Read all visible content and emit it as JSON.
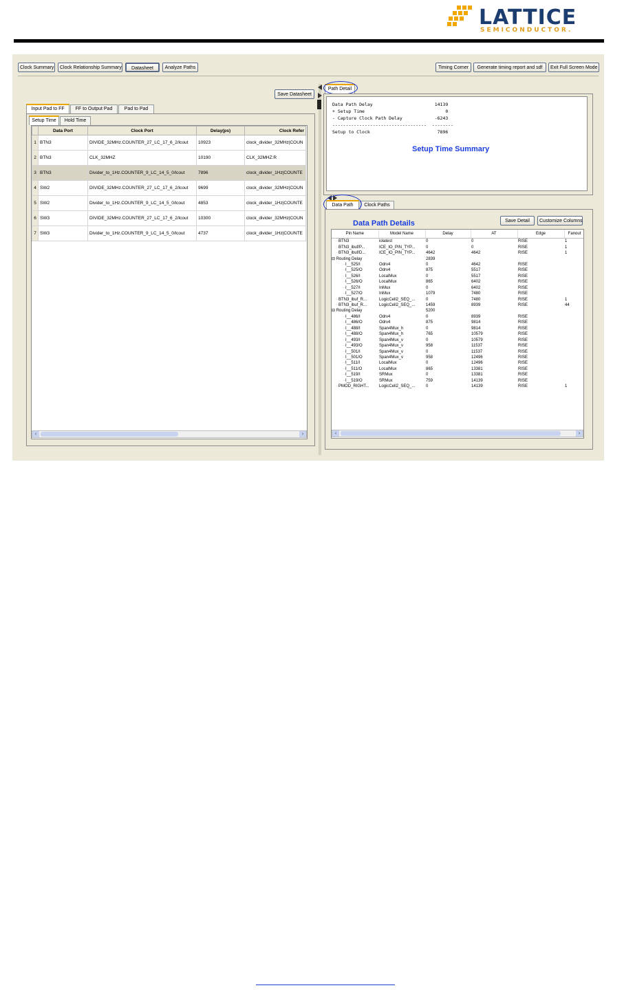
{
  "header": {
    "logo_word": "LATTICE",
    "logo_sub": "SEMICONDUCTOR."
  },
  "toolbar": {
    "clock_summary": "Clock Summary",
    "clock_relationship_summary": "Clock Relationship Summary",
    "datasheet": "Datasheet",
    "analyze_paths": "Analyze Paths",
    "timing_corner": "Timing Corner",
    "generate_report": "Generate timing report and sdf",
    "exit_full_screen": "Exit Full Screen Mode"
  },
  "left": {
    "save_datasheet": "Save Datasheet",
    "tabs": [
      "Input Pad to FF",
      "FF to Output Pad",
      "Pad to Pad"
    ],
    "subtabs": [
      "Setup Time",
      "Hold Time"
    ],
    "columns": [
      "Data Port",
      "Clock Port",
      "Delay(ps)",
      "Clock Refer"
    ],
    "rows": [
      [
        "1",
        "BTN3",
        "DIVIDE_32MHz.COUNTER_27_LC_17_6_2/lcout",
        "10923",
        "clock_divider_32MHz|COUN"
      ],
      [
        "2",
        "BTN3",
        "CLK_32MHZ",
        "10190",
        "CLK_32MHZ:R"
      ],
      [
        "3",
        "BTN3",
        "Divider_to_1Hz.COUNTER_9_LC_14_5_0/lcout",
        "7896",
        "clock_divider_1Hz|COUNTE"
      ],
      [
        "4",
        "SW2",
        "DIVIDE_32MHz.COUNTER_27_LC_17_6_2/lcout",
        "9699",
        "clock_divider_32MHz|COUN"
      ],
      [
        "5",
        "SW2",
        "Divider_to_1Hz.COUNTER_9_LC_14_5_0/lcout",
        "4853",
        "clock_divider_1Hz|COUNTE"
      ],
      [
        "6",
        "SW3",
        "DIVIDE_32MHz.COUNTER_27_LC_17_6_2/lcout",
        "10300",
        "clock_divider_32MHz|COUN"
      ],
      [
        "7",
        "SW3",
        "Divider_to_1Hz.COUNTER_9_LC_14_5_0/lcout",
        "4737",
        "clock_divider_1Hz|COUNTE"
      ]
    ]
  },
  "right": {
    "path_detail_tab": "Path Detail",
    "summary_text": "Data Path Delay                       14139\n+ Setup Time                              0\n- Capture Clock Path Delay            -6243\n-----------------------------------  --------\nSetup to Clock                         7896",
    "setup_time_summary": "Setup Time Summary",
    "subtabs": [
      "Data Path",
      "Clock Paths"
    ],
    "data_path_details": "Data Path Details",
    "save_detail": "Save Detail",
    "customize_columns": "Customize Columns",
    "grid_columns": [
      "Pin Name",
      "Model Name",
      "Delay",
      "AT",
      "Edge",
      "Fanout"
    ],
    "grid_rows": [
      {
        "lvl": 1,
        "pin": "BTN3",
        "model": "iolatest",
        "delay": "0",
        "at": "0",
        "edge": "RISE",
        "fanout": "1"
      },
      {
        "lvl": 1,
        "pin": "BTN3_ibuf/P...",
        "model": "ICE_IO_PIN_TYP...",
        "delay": "0",
        "at": "0",
        "edge": "RISE",
        "fanout": "1"
      },
      {
        "lvl": 1,
        "pin": "BTN3_ibuf/D...",
        "model": "ICE_IO_PIN_TYP...",
        "delay": "4642",
        "at": "4642",
        "edge": "RISE",
        "fanout": "1"
      },
      {
        "lvl": 0,
        "pin": "Routing Delay",
        "model": "",
        "delay": "2839",
        "at": "",
        "edge": "",
        "fanout": ""
      },
      {
        "lvl": 2,
        "pin": "I__525/I",
        "model": "Odrv4",
        "delay": "0",
        "at": "4642",
        "edge": "RISE",
        "fanout": ""
      },
      {
        "lvl": 2,
        "pin": "I__525/O",
        "model": "Odrv4",
        "delay": "875",
        "at": "5517",
        "edge": "RISE",
        "fanout": ""
      },
      {
        "lvl": 2,
        "pin": "I__526/I",
        "model": "LocalMux",
        "delay": "0",
        "at": "5517",
        "edge": "RISE",
        "fanout": ""
      },
      {
        "lvl": 2,
        "pin": "I__526/O",
        "model": "LocalMux",
        "delay": "865",
        "at": "6402",
        "edge": "RISE",
        "fanout": ""
      },
      {
        "lvl": 2,
        "pin": "I__527/I",
        "model": "InMux",
        "delay": "0",
        "at": "6402",
        "edge": "RISE",
        "fanout": ""
      },
      {
        "lvl": 2,
        "pin": "I__527/O",
        "model": "InMux",
        "delay": "1079",
        "at": "7480",
        "edge": "RISE",
        "fanout": ""
      },
      {
        "lvl": 1,
        "pin": "BTN3_ibuf_R...",
        "model": "LogicCell2_SEQ_...",
        "delay": "0",
        "at": "7480",
        "edge": "RISE",
        "fanout": "1"
      },
      {
        "lvl": 1,
        "pin": "BTN3_ibuf_R...",
        "model": "LogicCell2_SEQ_...",
        "delay": "1459",
        "at": "8939",
        "edge": "RISE",
        "fanout": "44"
      },
      {
        "lvl": 0,
        "pin": "Routing Delay",
        "model": "",
        "delay": "5200",
        "at": "",
        "edge": "",
        "fanout": ""
      },
      {
        "lvl": 2,
        "pin": "I__486/I",
        "model": "Odrv4",
        "delay": "0",
        "at": "8939",
        "edge": "RISE",
        "fanout": ""
      },
      {
        "lvl": 2,
        "pin": "I__486/O",
        "model": "Odrv4",
        "delay": "875",
        "at": "9814",
        "edge": "RISE",
        "fanout": ""
      },
      {
        "lvl": 2,
        "pin": "I__488/I",
        "model": "Span4Mux_h",
        "delay": "0",
        "at": "9814",
        "edge": "RISE",
        "fanout": ""
      },
      {
        "lvl": 2,
        "pin": "I__488/O",
        "model": "Span4Mux_h",
        "delay": "765",
        "at": "10579",
        "edge": "RISE",
        "fanout": ""
      },
      {
        "lvl": 2,
        "pin": "I__493/I",
        "model": "Span4Mux_v",
        "delay": "0",
        "at": "10579",
        "edge": "RISE",
        "fanout": ""
      },
      {
        "lvl": 2,
        "pin": "I__493/O",
        "model": "Span4Mux_v",
        "delay": "958",
        "at": "11537",
        "edge": "RISE",
        "fanout": ""
      },
      {
        "lvl": 2,
        "pin": "I__501/I",
        "model": "Span4Mux_v",
        "delay": "0",
        "at": "11537",
        "edge": "RISE",
        "fanout": ""
      },
      {
        "lvl": 2,
        "pin": "I__501/O",
        "model": "Span4Mux_v",
        "delay": "958",
        "at": "12496",
        "edge": "RISE",
        "fanout": ""
      },
      {
        "lvl": 2,
        "pin": "I__511/I",
        "model": "LocalMux",
        "delay": "0",
        "at": "12496",
        "edge": "RISE",
        "fanout": ""
      },
      {
        "lvl": 2,
        "pin": "I__511/O",
        "model": "LocalMux",
        "delay": "865",
        "at": "13381",
        "edge": "RISE",
        "fanout": ""
      },
      {
        "lvl": 2,
        "pin": "I__519/I",
        "model": "SRMux",
        "delay": "0",
        "at": "13381",
        "edge": "RISE",
        "fanout": ""
      },
      {
        "lvl": 2,
        "pin": "I__519/O",
        "model": "SRMux",
        "delay": "759",
        "at": "14139",
        "edge": "RISE",
        "fanout": ""
      },
      {
        "lvl": 1,
        "pin": "PMOD_RIGHT...",
        "model": "LogicCell2_SEQ_...",
        "delay": "0",
        "at": "14139",
        "edge": "RISE",
        "fanout": "1"
      }
    ]
  },
  "colors": {
    "app_bg": "#ece9d8",
    "annotation_blue": "#1a3ee0",
    "logo_blue": "#1b3d6f",
    "logo_orange": "#e09c1a"
  }
}
